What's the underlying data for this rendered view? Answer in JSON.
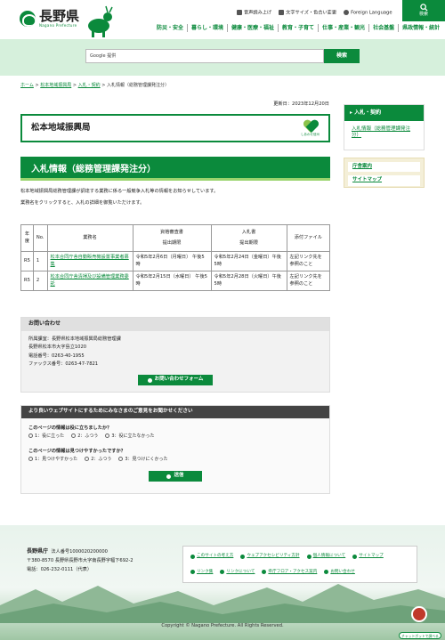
{
  "header": {
    "logo_text": "長野県",
    "logo_sub": "Nagano Prefecture",
    "util": {
      "voice": "音声読み上げ",
      "font": "文字サイズ・色合い変更",
      "lang": "Foreign Language"
    },
    "search_label": "検索",
    "nav": [
      "防災・安全",
      "暮らし・環境",
      "健康・医療・福祉",
      "教育・子育て",
      "仕事・産業・観光",
      "社会基盤",
      "県政情報・統計"
    ]
  },
  "search": {
    "placeholder": "Google 提供",
    "button": "検索"
  },
  "breadcrumb": {
    "items": [
      "ホーム",
      "松本地域振興局",
      "入札・契約"
    ],
    "current": "入札情報（総務管理課発注分）"
  },
  "updated": "更新日：2023年12月20日",
  "office": {
    "name": "松本地域振興局",
    "logo_caption": "しあわせ信州"
  },
  "page": {
    "title": "入札情報（総務管理課発注分）",
    "intro1": "松本地域振興局総務管理課が調達する業務に係る一般競争入札等の情報をお知らせしています。",
    "intro2": "業務名をクリックすると、入札の詳細を御覧いただけます。"
  },
  "table": {
    "headers": {
      "year": "年度",
      "no": "No.",
      "name": "業務名",
      "doc": "資格審査書",
      "doc2": "提出期限",
      "bid": "入札書",
      "bid2": "提出期限",
      "file": "添付ファイル"
    },
    "rows": [
      {
        "year": "R5",
        "no": "1",
        "name": "松本合同庁舎自動販売機設置事業者募集",
        "doc": "令和5年2月6日（月曜日） 午後5時",
        "bid": "令和5年2月24日（金曜日）午後5時",
        "file": "左記リンク先を参照のこと"
      },
      {
        "year": "R5",
        "no": "2",
        "name": "松本合同庁舎清掃及び設備管理業務委託",
        "doc": "令和5年2月15日（水曜日） 午後5時",
        "bid": "令和5年2月28日（火曜日）午後5時",
        "file": "左記リンク先を参照のこと"
      }
    ]
  },
  "contact": {
    "heading": "お問い合わせ",
    "dept": "所属課室：長野県松本地域振興局総務管理課",
    "address": "長野県松本市大字島立1020",
    "tel": "電話番号：0263-40-1955",
    "fax": "ファックス番号：0263-47-7821",
    "button": "お問い合わせフォーム"
  },
  "survey": {
    "heading": "より良いウェブサイトにするためにみなさまのご意見をお聞かせください",
    "q1": "このページの情報は役に立ちましたか？",
    "q1_opts": [
      "1：役に立った",
      "2：ふつう",
      "3：役に立たなかった"
    ],
    "q2": "このページの情報は見つけやすかったですか？",
    "q2_opts": [
      "1：見つけやすかった",
      "2：ふつう",
      "3：見つけにくかった"
    ],
    "submit": "送信"
  },
  "sidebar": {
    "heading": "入札・契約",
    "link": "入札情報（総務管理課発注分）",
    "extra": [
      "庁舎案内",
      "サイトマップ"
    ]
  },
  "footer": {
    "org": "長野県庁",
    "corp": "法人番号1000020200000",
    "address": "〒380-8570 長野県長野市大字南長野字幅下692-2",
    "tel": "電話：026-232-0111（代表）",
    "links": [
      "このサイトの考え方",
      "ウェブアクセシビリティ方針",
      "個人情報について",
      "サイトマップ",
      "リンク集",
      "リンクについて",
      "県庁フロア・アクセス案内",
      "お問い合わせ"
    ],
    "copyright": "Copyright © Nagano Prefecture. All Rights Reserved.",
    "chatbot": "チャットボットで調べる"
  }
}
